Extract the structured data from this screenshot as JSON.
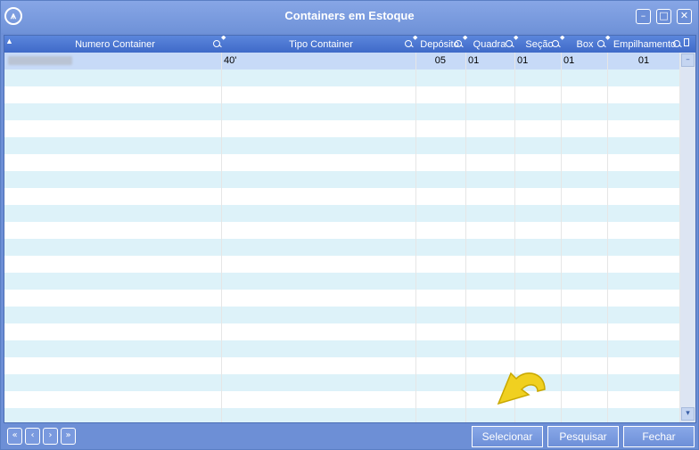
{
  "window": {
    "title": "Containers em Estoque",
    "logo_glyph": "⩚"
  },
  "window_controls": {
    "minimize": "–",
    "maximize": "□",
    "close": "✕"
  },
  "columns": [
    {
      "key": "numero",
      "label": "Numero Container"
    },
    {
      "key": "tipo",
      "label": "Tipo Container"
    },
    {
      "key": "deposito",
      "label": "Depósito"
    },
    {
      "key": "quadra",
      "label": "Quadra"
    },
    {
      "key": "secao",
      "label": "Seção"
    },
    {
      "key": "box",
      "label": "Box"
    },
    {
      "key": "empilhamento",
      "label": "Empilhamento"
    }
  ],
  "rows": [
    {
      "numero": "",
      "tipo": "40'",
      "deposito": "05",
      "quadra": "01",
      "secao": "01",
      "box": "01",
      "empilhamento": "01",
      "selected": true
    }
  ],
  "empty_row_count": 21,
  "scrollbar": {
    "up": "–",
    "down": "▾"
  },
  "nav_buttons": {
    "first": "«",
    "prev": "‹",
    "next": "›",
    "last": "»"
  },
  "actions": {
    "selecionar": "Selecionar",
    "pesquisar": "Pesquisar",
    "fechar": "Fechar"
  },
  "colors": {
    "title_bg": "#7a9adf",
    "header_bg": "#4a74cf",
    "alt_row": "#ddf2f9",
    "cursor": "#f0d020"
  }
}
